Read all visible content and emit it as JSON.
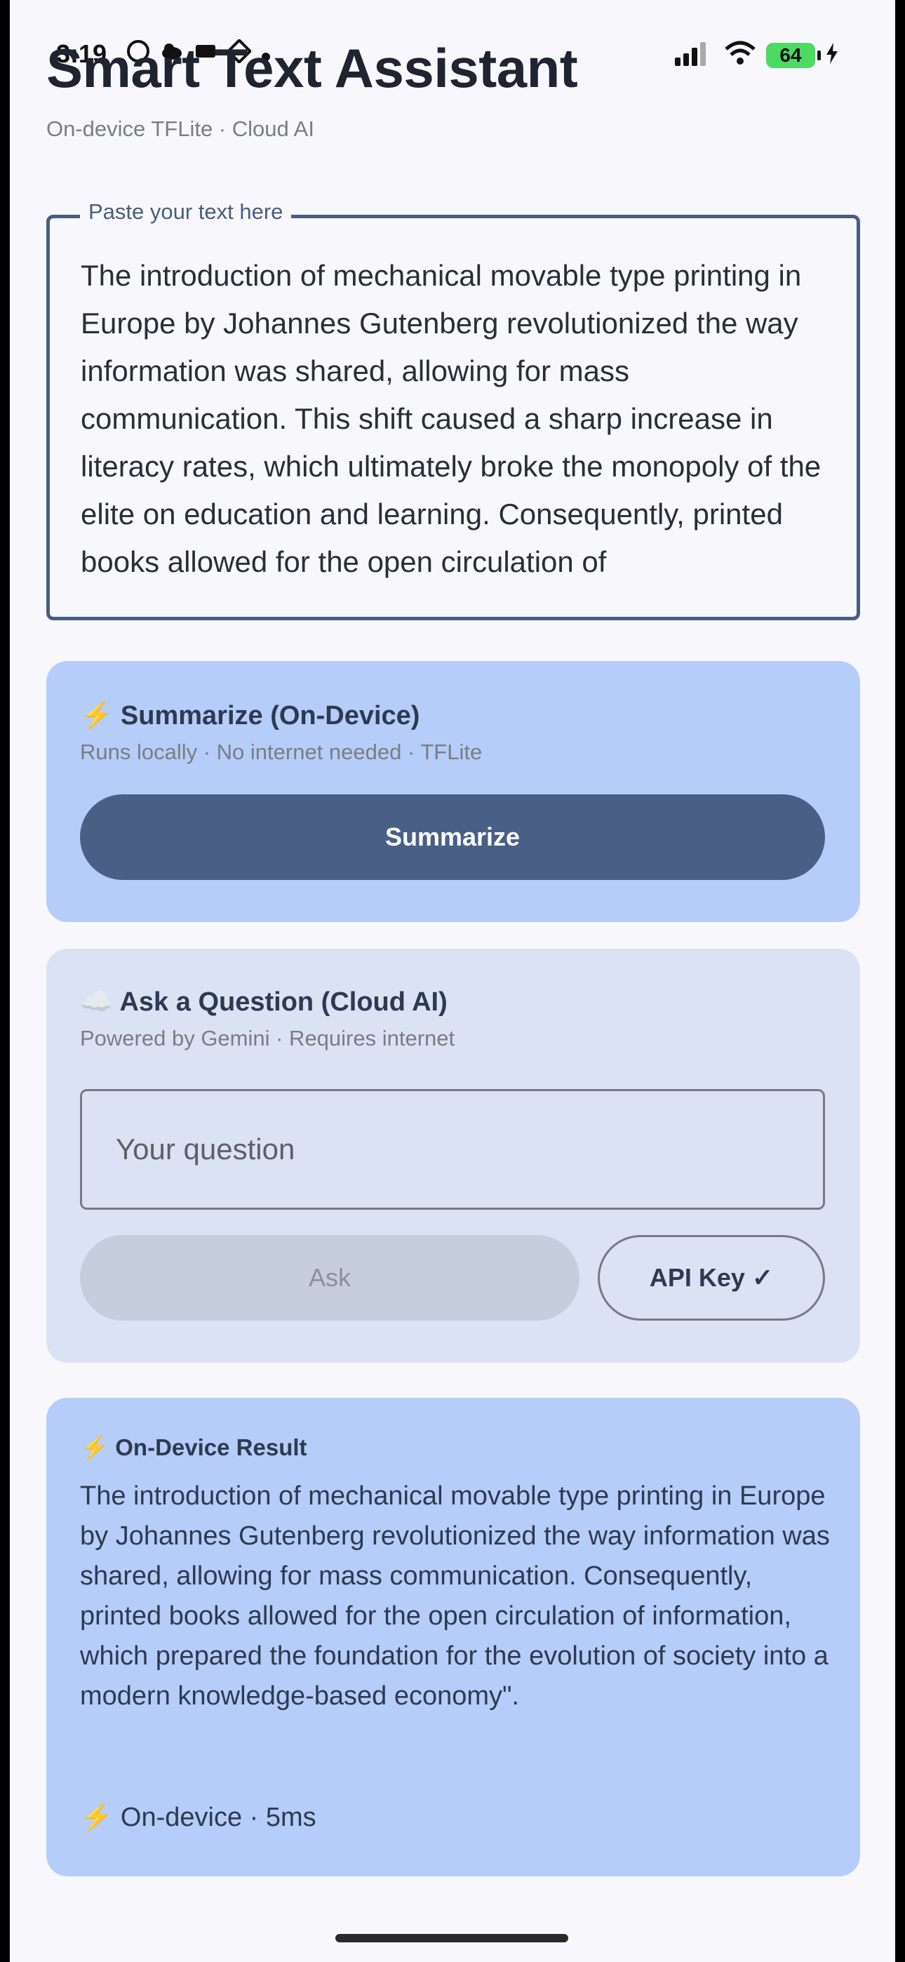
{
  "status": {
    "time": "3:19",
    "left_icons": [
      "whatsapp-icon",
      "cloud-icon",
      "taxi-icon",
      "grid-icon",
      "dot-icon"
    ],
    "battery": "64"
  },
  "app": {
    "title": "Smart Text Assistant",
    "subtitle": "On-device TFLite  ·  Cloud AI"
  },
  "input": {
    "label": "Paste your text here",
    "value": "The introduction of mechanical movable type printing in Europe by Johannes Gutenberg revolutionized the way information was shared, allowing for mass communication. This shift caused a sharp increase in literacy rates, which ultimately broke the monopoly of the elite on education and learning. Consequently, printed books allowed for the open circulation of"
  },
  "summarize": {
    "icon": "⚡",
    "title": "Summarize (On-Device)",
    "subtitle": "Runs locally · No internet needed · TFLite",
    "button": "Summarize"
  },
  "ask": {
    "icon": "☁️",
    "title": "Ask a Question (Cloud AI)",
    "subtitle": "Powered by Gemini · Requires internet",
    "placeholder": "Your question",
    "ask_button": "Ask",
    "api_button": "API Key ✓"
  },
  "result": {
    "icon": "⚡",
    "title": "On-Device Result",
    "body": "The introduction of mechanical movable type printing in Europe by Johannes Gutenberg revolutionized the way information was shared, allowing for mass communication. Consequently, printed books allowed for the open circulation of information, which prepared the foundation for the evolution of society into a modern knowledge-based economy\".",
    "footer": "On-device · 5ms"
  }
}
